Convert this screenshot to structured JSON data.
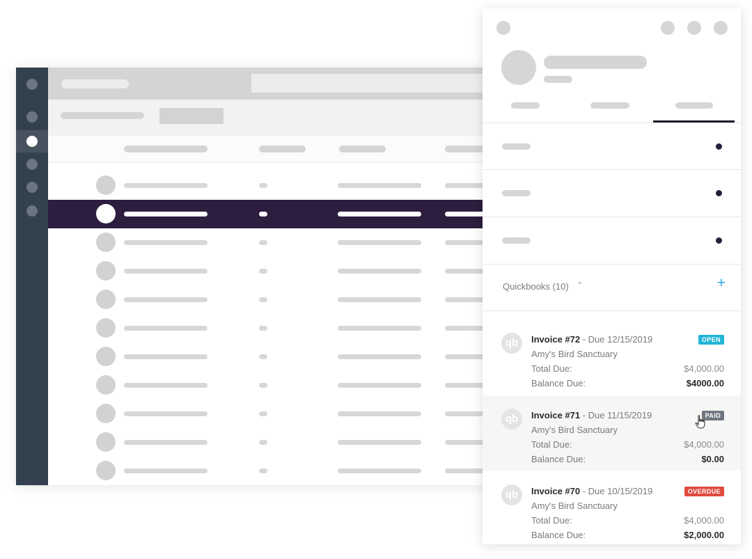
{
  "panel": {
    "section_title": "Quickbooks (10)",
    "section_chevron": "⌃",
    "add_symbol": "+",
    "logo_text": "qb",
    "invoices": [
      {
        "title": "Invoice #72",
        "due": " - Due 12/15/2019",
        "customer": "Amy's Bird Sanctuary",
        "status": "OPEN",
        "status_color": "#1fb5d6",
        "total_label": "Total Due:",
        "total_value": "$4,000.00",
        "balance_label": "Balance Due:",
        "balance_value": "$4000.00"
      },
      {
        "title": "Invoice #71",
        "due": " - Due 11/15/2019",
        "customer": "Amy's Bird Sanctuary",
        "status": "PAID",
        "status_color": "#707780",
        "total_label": "Total Due:",
        "total_value": "$4,000.00",
        "balance_label": "Balance Due:",
        "balance_value": "$0.00"
      },
      {
        "title": "Invoice #70",
        "due": " - Due 10/15/2019",
        "customer": "Amy's Bird Sanctuary",
        "status": "OVERDUE",
        "status_color": "#e04b3e",
        "total_label": "Total Due:",
        "total_value": "$4,000.00",
        "balance_label": "Balance Due:",
        "balance_value": "$2,000.00"
      }
    ]
  },
  "colors": {
    "rail": "#33414e",
    "selected_row": "#2d1d3e",
    "accent_add": "#27a6df"
  },
  "icons": {
    "add": "plus-icon",
    "collapse": "chevron-up-icon",
    "cursor": "hand-pointer-icon",
    "logo": "quickbooks-logo-icon"
  }
}
